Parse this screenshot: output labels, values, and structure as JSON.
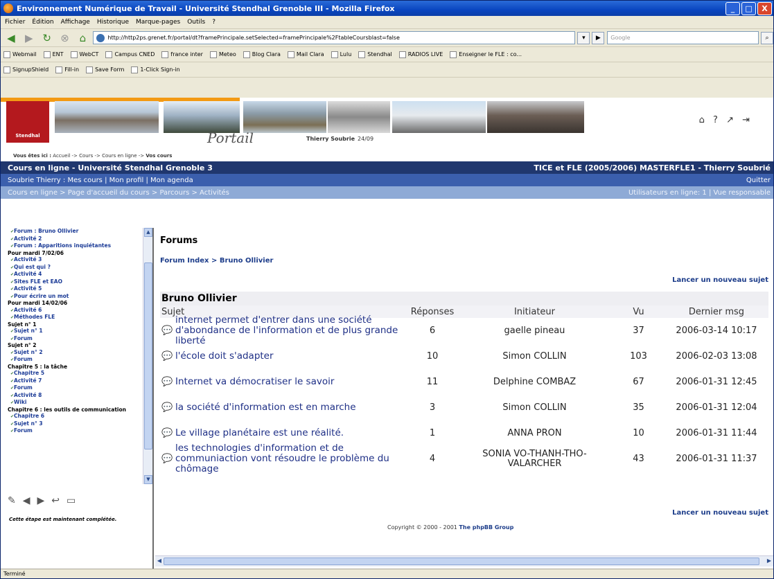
{
  "window": {
    "title": "Environnement Numérique de Travail - Université Stendhal Grenoble III - Mozilla Firefox",
    "min": "_",
    "max": "□",
    "close": "X"
  },
  "menu": [
    "Fichier",
    "Édition",
    "Affichage",
    "Historique",
    "Marque-pages",
    "Outils",
    "?"
  ],
  "nav": {
    "url": "http://http2ps.grenet.fr/portal/dt?framePrincipale.setSelected=framePrincipale%2FtableCoursblast=false",
    "search_placeholder": "Google"
  },
  "bookmarks": [
    "Webmail",
    "ENT",
    "WebCT",
    "Campus CNED",
    "france inter",
    "Meteo",
    "Blog Clara",
    "Mail Clara",
    "Lulu",
    "Stendhal",
    "RADIOS LIVE",
    "Enseigner le FLE : co..."
  ],
  "toolbar2": [
    "SignupShield",
    "Fill-in",
    "Save Form",
    "1-Click Sign-in"
  ],
  "banner": {
    "logo": "Stendhal",
    "portal": "Portail",
    "user": "Thierry Soubrie",
    "date": "24/09",
    "icons": "⌂ ? ↗ ⇥"
  },
  "breadcrumb": {
    "prefix": "Vous êtes ici :",
    "path": "Accueil -> Cours -> Cours en ligne ->",
    "current": "Vos cours"
  },
  "bar1": {
    "left": "Cours en ligne - Université Stendhal Grenoble 3",
    "right": "TICE et FLE (2005/2006) MASTERFLE1 - Thierry Soubrié"
  },
  "bar2": {
    "left": "Soubrie Thierry : Mes cours | Mon profil | Mon agenda",
    "right": "Quitter"
  },
  "bar3": {
    "left": "Cours en ligne > Page d'accueil du cours > Parcours > Activités",
    "right": "Utilisateurs en ligne: 1 | Vue responsable"
  },
  "toc": [
    {
      "t": "Forum : Bruno Ollivier",
      "k": "it"
    },
    {
      "t": "Activité 2",
      "k": "it"
    },
    {
      "t": "Forum : Apparitions inquiétantes",
      "k": "it"
    },
    {
      "t": "Pour mardi 7/02/06",
      "k": "sec"
    },
    {
      "t": "Activité 3",
      "k": "it"
    },
    {
      "t": "Qui est qui ?",
      "k": "it"
    },
    {
      "t": "Activité 4",
      "k": "it"
    },
    {
      "t": "Sites FLE et EAO",
      "k": "it"
    },
    {
      "t": "Activité 5",
      "k": "it"
    },
    {
      "t": "Pour écrire un mot",
      "k": "it"
    },
    {
      "t": "Pour mardi 14/02/06",
      "k": "sec"
    },
    {
      "t": "Activité 6",
      "k": "it"
    },
    {
      "t": "Méthodes FLE",
      "k": "it"
    },
    {
      "t": "Sujet n° 1",
      "k": "sec"
    },
    {
      "t": "Sujet n° 1",
      "k": "it"
    },
    {
      "t": "Forum",
      "k": "it"
    },
    {
      "t": "Sujet n° 2",
      "k": "sec"
    },
    {
      "t": "Sujet n° 2",
      "k": "it"
    },
    {
      "t": "Forum",
      "k": "it"
    },
    {
      "t": "Chapitre 5 : la tâche",
      "k": "sec"
    },
    {
      "t": "Chapitre 5",
      "k": "it"
    },
    {
      "t": "Activité 7",
      "k": "it"
    },
    {
      "t": "Forum",
      "k": "it"
    },
    {
      "t": "Activité 8",
      "k": "it"
    },
    {
      "t": "Wiki",
      "k": "it"
    },
    {
      "t": "Chapitre 6 : les outils de communication",
      "k": "sec"
    },
    {
      "t": "Chapitre 6",
      "k": "it"
    },
    {
      "t": "Sujet n° 3",
      "k": "it"
    },
    {
      "t": "Forum",
      "k": "it"
    }
  ],
  "left_note": "Cette étape est maintenant complétée.",
  "forums": {
    "heading": "Forums",
    "index": "Forum Index > Bruno Ollivier",
    "new_topic": "Lancer un nouveau sujet",
    "forum_name": "Bruno Ollivier",
    "cols": [
      "Sujet",
      "Réponses",
      "Initiateur",
      "Vu",
      "Dernier msg"
    ],
    "rows": [
      {
        "topic": "internet permet d'entrer dans une société d'abondance de l'information et de plus grande liberté",
        "replies": "6",
        "author": "gaelle pineau",
        "views": "37",
        "last": "2006-03-14 10:17"
      },
      {
        "topic": "l'école doit s'adapter",
        "replies": "10",
        "author": "Simon COLLIN",
        "views": "103",
        "last": "2006-02-03 13:08"
      },
      {
        "topic": "Internet va démocratiser le savoir",
        "replies": "11",
        "author": "Delphine COMBAZ",
        "views": "67",
        "last": "2006-01-31 12:45"
      },
      {
        "topic": "la société d'information est en marche",
        "replies": "3",
        "author": "Simon COLLIN",
        "views": "35",
        "last": "2006-01-31 12:04"
      },
      {
        "topic": "Le village planétaire est une réalité.",
        "replies": "1",
        "author": "ANNA PRON",
        "views": "10",
        "last": "2006-01-31 11:44"
      },
      {
        "topic": "les technologies d'information et de communiaction vont résoudre le problème du chômage",
        "replies": "4",
        "author": "SONIA VO-THANH-THO-VALARCHER",
        "views": "43",
        "last": "2006-01-31 11:37"
      }
    ],
    "copyright": "Copyright © 2000 - 2001",
    "copyright_link": "The phpBB Group"
  },
  "status": "Terminé"
}
